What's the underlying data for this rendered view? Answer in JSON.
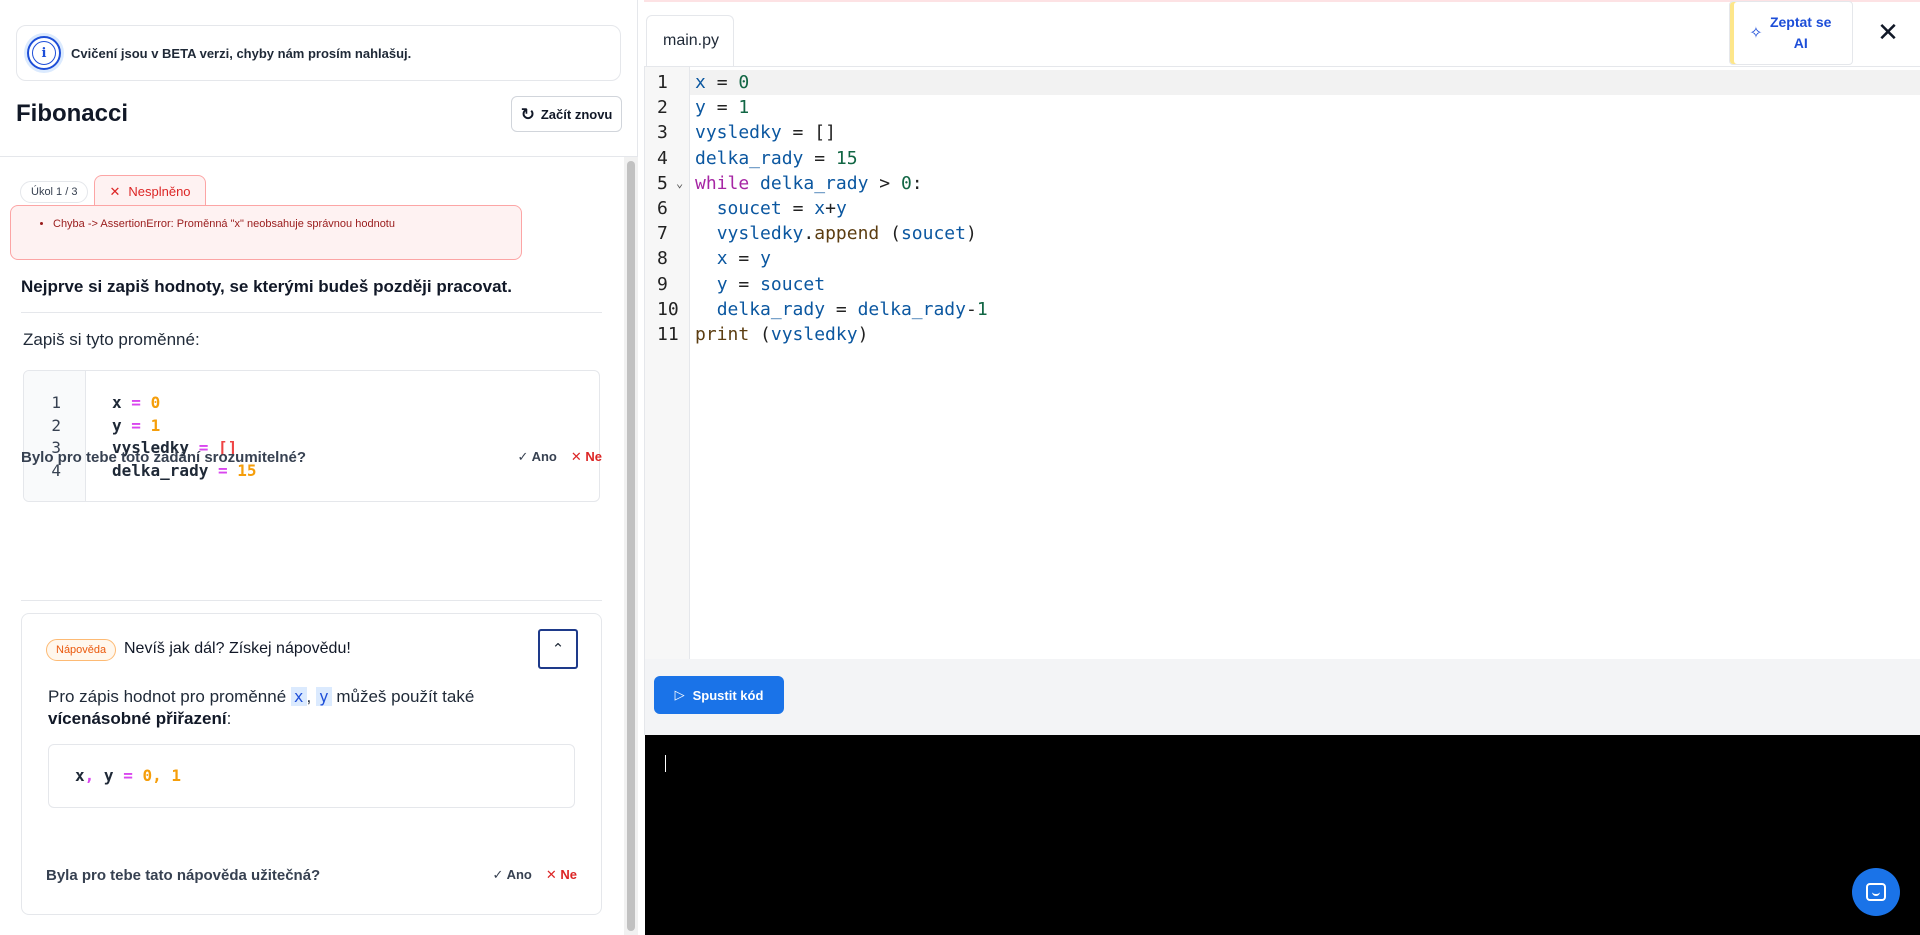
{
  "banner": {
    "text": "Cvičení jsou v BETA verzi, chyby nám prosím nahlašuj."
  },
  "exercise": {
    "title": "Fibonacci",
    "restart_label": "Začít znovu"
  },
  "task": {
    "counter": "Úkol 1 / 3",
    "status_tab": "Nesplněno",
    "error": "Chyba -> AssertionError: Proměnná \"x\" neobsahuje správnou hodnotu",
    "heading": "Nejprve si zapiš hodnoty, se kterými budeš později pracovat.",
    "intro": "Zapiš si tyto proměnné:",
    "code_lines": [
      {
        "n": "1",
        "name": "x",
        "eq": "=",
        "val": "0"
      },
      {
        "n": "2",
        "name": "y",
        "eq": "=",
        "val": "1"
      },
      {
        "n": "3",
        "name": "vysledky",
        "eq": "=",
        "val": "[]"
      },
      {
        "n": "4",
        "name": "delka_rady",
        "eq": "=",
        "val": "15"
      }
    ]
  },
  "feedback1": {
    "question": "Bylo pro tebe toto zadání srozumitelné?",
    "yes": "Ano",
    "no": "Ne"
  },
  "hint": {
    "badge": "Nápověda",
    "title": "Nevíš jak dál? Získej nápovědu!",
    "text_part1": "Pro zápis hodnot pro proměnné ",
    "code_x": "x",
    "sep": ", ",
    "code_y": "y",
    "text_part2": " můžeš použít také ",
    "bold": "vícenásobné přiřazení",
    "colon": ":",
    "example": {
      "a": "x",
      "comma1": ",",
      "b": "y",
      "eq": "=",
      "v1": "0",
      "comma2": ",",
      "v2": "1"
    },
    "feedback": {
      "question": "Byla pro tebe tato nápověda užitečná?",
      "yes": "Ano",
      "no": "Ne"
    }
  },
  "editor": {
    "filename": "main.py",
    "ask_ai": "Zeptat se AI",
    "run_label": "Spustit kód",
    "line_numbers": [
      "1",
      "2",
      "3",
      "4",
      "5",
      "6",
      "7",
      "8",
      "9",
      "10",
      "11"
    ],
    "code": [
      "x = 0",
      "y = 1",
      "vysledky = []",
      "delka_rady = 15",
      "while delka_rady > 0:",
      "  soucet = x+y",
      "  vysledky.append (soucet)",
      "  x = y",
      "  y = soucet",
      "  delka_rady = delka_rady-1",
      "print (vysledky)"
    ]
  },
  "colors": {
    "accent": "#1a73e8",
    "error": "#dc2626",
    "console_bg": "#000000"
  },
  "icons": [
    "info-icon",
    "refresh-icon",
    "close-icon",
    "check-icon",
    "x-icon",
    "chevron-up-icon",
    "sparkle-icon",
    "play-icon",
    "fold-chevron-icon",
    "chat-icon"
  ]
}
